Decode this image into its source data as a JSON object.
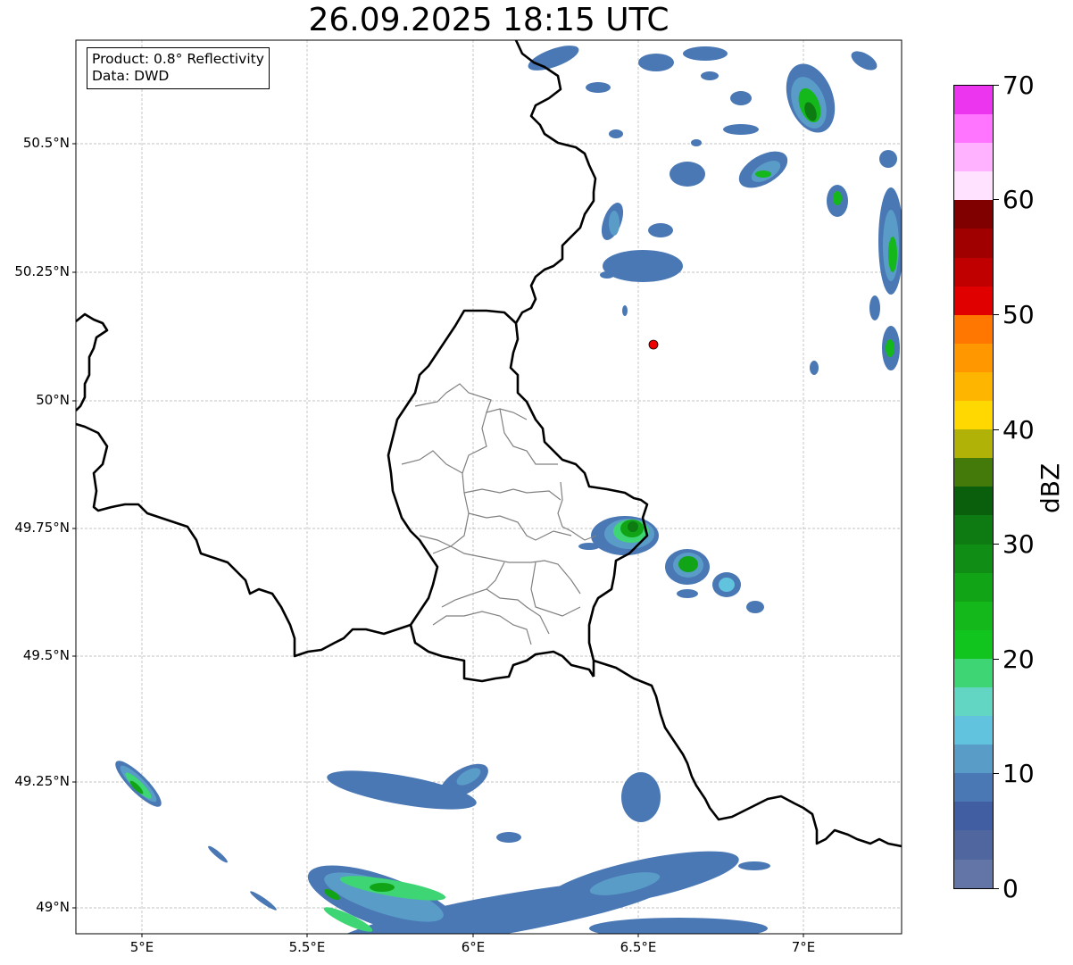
{
  "title": "26.09.2025 18:15 UTC",
  "info": {
    "product_line": "Product: 0.8° Reflectivity",
    "data_line": "Data: DWD"
  },
  "axes": {
    "lat_ticks": [
      "50.5°N",
      "50.25°N",
      "50°N",
      "49.75°N",
      "49.5°N",
      "49.25°N",
      "49°N"
    ],
    "lon_ticks": [
      "5°E",
      "5.5°E",
      "6°E",
      "6.5°E",
      "7°E"
    ]
  },
  "colorbar": {
    "label": "dBZ",
    "tick_labels": [
      "0",
      "10",
      "20",
      "30",
      "40",
      "50",
      "60",
      "70"
    ],
    "colors": [
      "#6374a7",
      "#4f669f",
      "#405ea1",
      "#4a78b5",
      "#5a9cc8",
      "#62c3de",
      "#62d6c3",
      "#3ed574",
      "#12c41e",
      "#14b81b",
      "#12a417",
      "#0f8d15",
      "#0d7a12",
      "#0a5f0d",
      "#447a0a",
      "#b0b208",
      "#fed800",
      "#feb500",
      "#ff9700",
      "#ff7700",
      "#e00000",
      "#c00000",
      "#a00000",
      "#800000",
      "#ffe2ff",
      "#ffb2ff",
      "#ff75ff",
      "#ec35ee"
    ]
  },
  "marker_color": "#ee0000",
  "border_color": "#000000",
  "district_color": "#808080"
}
